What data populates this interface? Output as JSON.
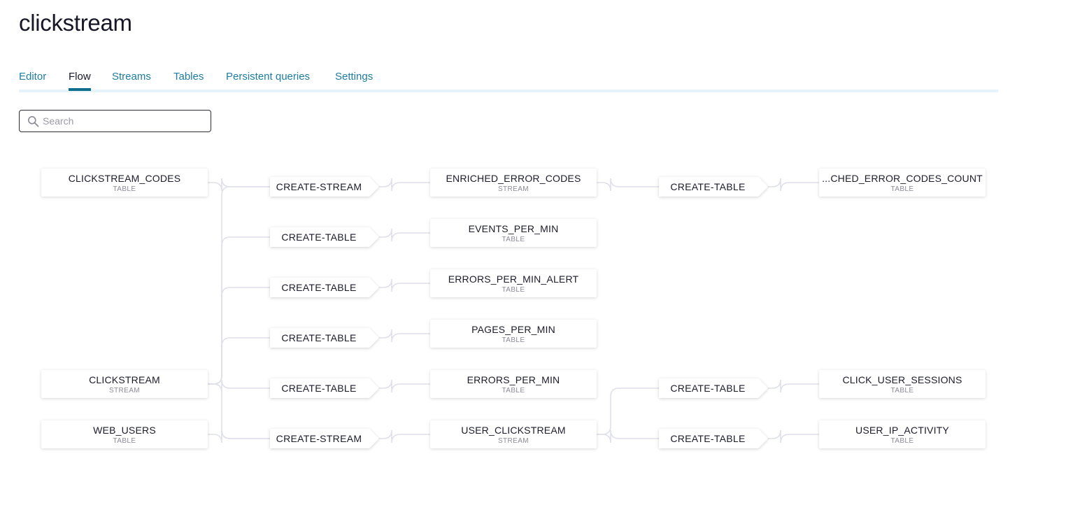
{
  "title": "clickstream",
  "tabs": [
    {
      "label": "Editor"
    },
    {
      "label": "Flow"
    },
    {
      "label": "Streams"
    },
    {
      "label": "Tables"
    },
    {
      "label": "Persistent queries"
    },
    {
      "label": "Settings"
    }
  ],
  "active_tab": "Flow",
  "search": {
    "placeholder": "Search",
    "value": ""
  },
  "flow": {
    "nodes": [
      {
        "id": "clickstream_codes",
        "name": "CLICKSTREAM_CODES",
        "type": "TABLE"
      },
      {
        "id": "clickstream",
        "name": "CLICKSTREAM",
        "type": "STREAM"
      },
      {
        "id": "web_users",
        "name": "WEB_USERS",
        "type": "TABLE"
      },
      {
        "id": "q1",
        "query": "CREATE-STREAM"
      },
      {
        "id": "q2",
        "query": "CREATE-TABLE"
      },
      {
        "id": "q3",
        "query": "CREATE-TABLE"
      },
      {
        "id": "q4",
        "query": "CREATE-TABLE"
      },
      {
        "id": "q5",
        "query": "CREATE-TABLE"
      },
      {
        "id": "q6",
        "query": "CREATE-STREAM"
      },
      {
        "id": "enriched_error_codes",
        "name": "ENRICHED_ERROR_CODES",
        "type": "STREAM"
      },
      {
        "id": "events_per_min",
        "name": "EVENTS_PER_MIN",
        "type": "TABLE"
      },
      {
        "id": "errors_per_min_alert",
        "name": "ERRORS_PER_MIN_ALERT",
        "type": "TABLE"
      },
      {
        "id": "pages_per_min",
        "name": "PAGES_PER_MIN",
        "type": "TABLE"
      },
      {
        "id": "errors_per_min",
        "name": "ERRORS_PER_MIN",
        "type": "TABLE"
      },
      {
        "id": "user_clickstream",
        "name": "USER_CLICKSTREAM",
        "type": "STREAM"
      },
      {
        "id": "q7",
        "query": "CREATE-TABLE"
      },
      {
        "id": "q8",
        "query": "CREATE-TABLE"
      },
      {
        "id": "q9",
        "query": "CREATE-TABLE"
      },
      {
        "id": "enriched_error_codes_count",
        "name": "...CHED_ERROR_CODES_COUNT",
        "type": "TABLE"
      },
      {
        "id": "click_user_sessions",
        "name": "CLICK_USER_SESSIONS",
        "type": "TABLE"
      },
      {
        "id": "user_ip_activity",
        "name": "USER_IP_ACTIVITY",
        "type": "TABLE"
      }
    ],
    "edges": [
      [
        "clickstream_codes",
        "q1"
      ],
      [
        "clickstream",
        "q1"
      ],
      [
        "clickstream",
        "q2"
      ],
      [
        "clickstream",
        "q3"
      ],
      [
        "clickstream",
        "q4"
      ],
      [
        "clickstream",
        "q5"
      ],
      [
        "clickstream",
        "q6"
      ],
      [
        "web_users",
        "q6"
      ],
      [
        "q1",
        "enriched_error_codes"
      ],
      [
        "q2",
        "events_per_min"
      ],
      [
        "q3",
        "errors_per_min_alert"
      ],
      [
        "q4",
        "pages_per_min"
      ],
      [
        "q5",
        "errors_per_min"
      ],
      [
        "q6",
        "user_clickstream"
      ],
      [
        "enriched_error_codes",
        "q7"
      ],
      [
        "user_clickstream",
        "q8"
      ],
      [
        "user_clickstream",
        "q9"
      ],
      [
        "q7",
        "enriched_error_codes_count"
      ],
      [
        "q8",
        "click_user_sessions"
      ],
      [
        "q9",
        "user_ip_activity"
      ]
    ]
  },
  "colors": {
    "edge": "#dfe0ea",
    "tab_link": "#1e7da0",
    "tab_active_underline": "#0e6e8c",
    "tab_track": "#e6f3fa"
  }
}
